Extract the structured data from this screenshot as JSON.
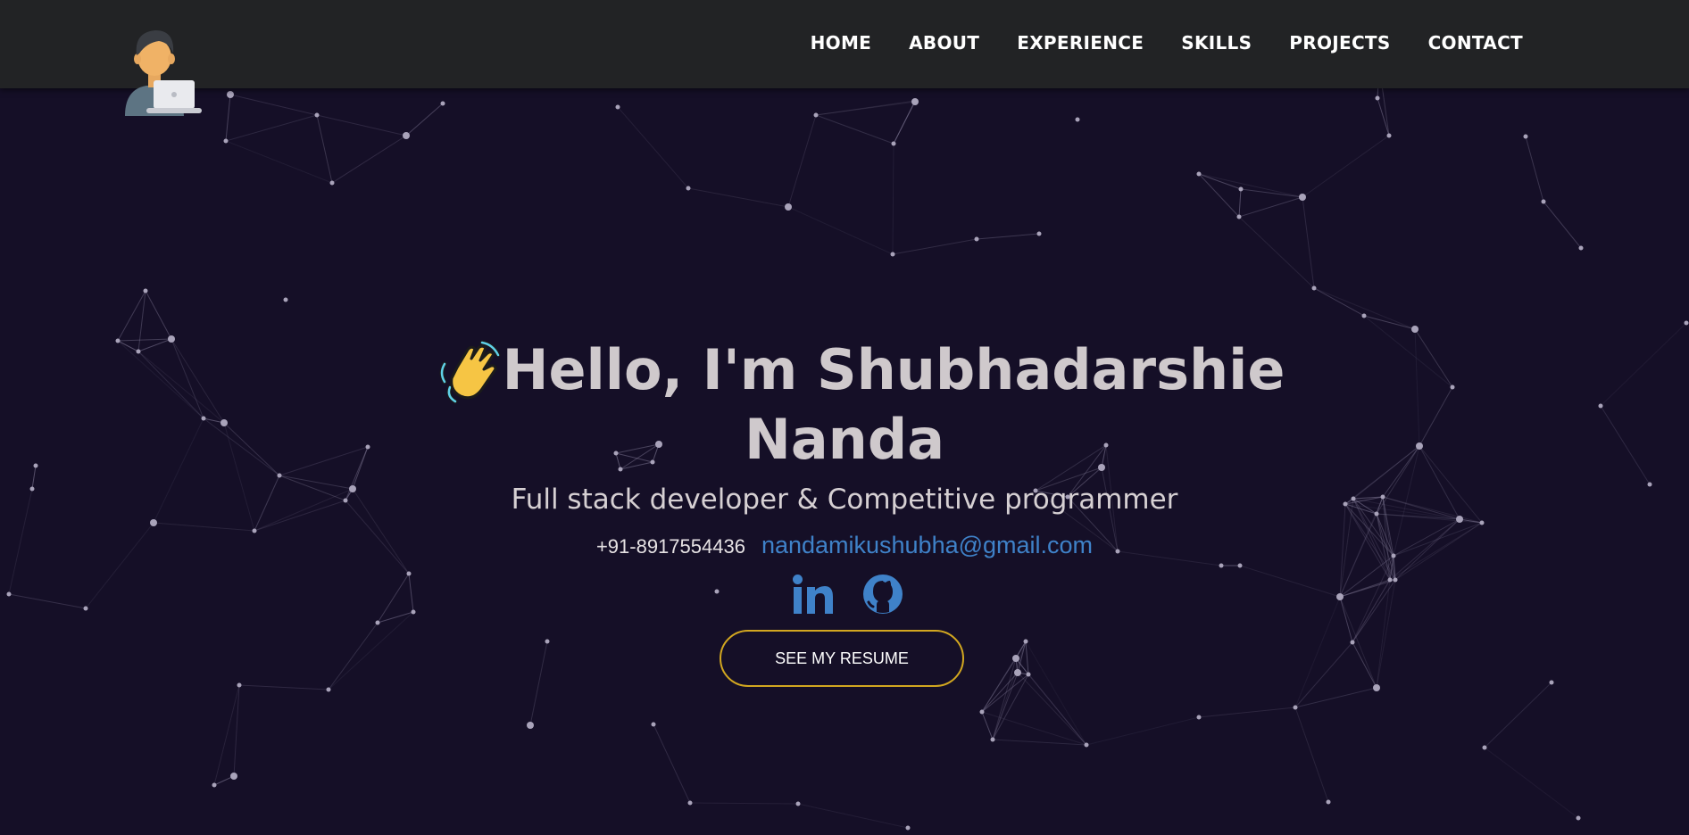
{
  "nav": {
    "items": [
      {
        "label": "HOME"
      },
      {
        "label": "ABOUT"
      },
      {
        "label": "EXPERIENCE"
      },
      {
        "label": "SKILLS"
      },
      {
        "label": "PROJECTS"
      },
      {
        "label": "CONTACT"
      }
    ]
  },
  "hero": {
    "greeting_line1": "Hello, I'm Shubhadarshie",
    "greeting_line2": "Nanda",
    "subtitle": "Full stack developer & Competitive programmer",
    "phone": "+91-8917554436",
    "email": "nandamikushubha@gmail.com",
    "resume_button": "SEE MY RESUME"
  },
  "icons": {
    "logo": "developer-avatar-icon",
    "wave": "waving-hand-icon",
    "linkedin": "linkedin-icon",
    "github": "github-icon"
  },
  "colors": {
    "background": "#150f27",
    "navbar": "#222325",
    "link_blue": "#3f82c9",
    "button_border": "#d2a720",
    "heading_text": "#cfc9cc"
  }
}
